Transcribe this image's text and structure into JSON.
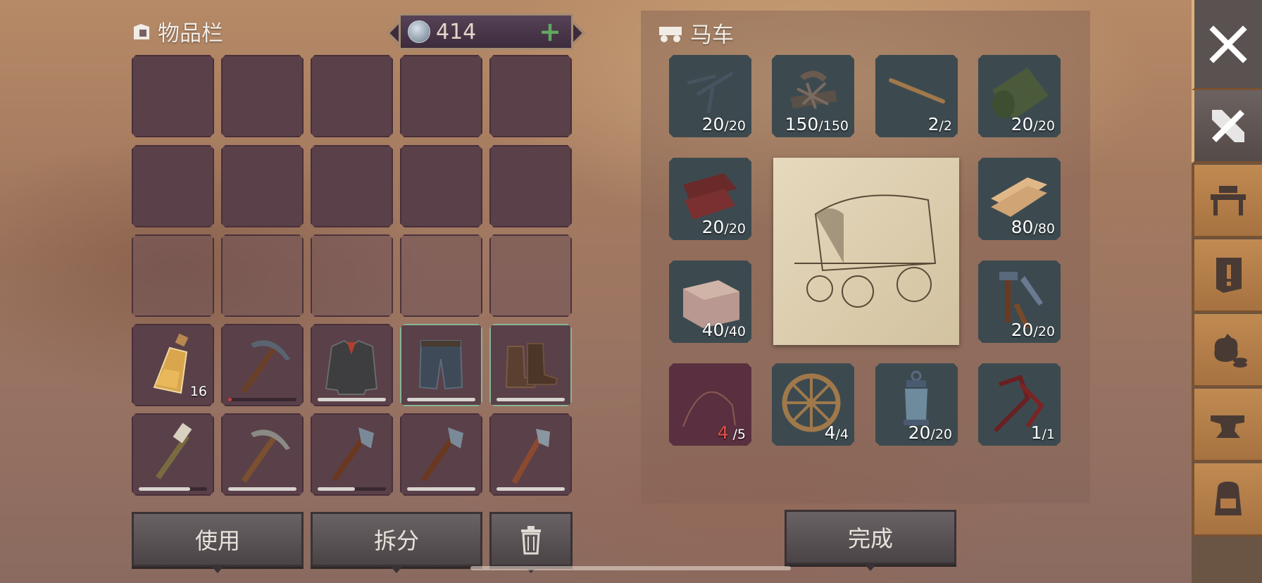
{
  "inventory": {
    "title": "物品栏",
    "currency": {
      "amount": "414",
      "add_symbol": "+"
    },
    "items": [
      {
        "name": "bottle",
        "count": "16"
      },
      {
        "name": "pickaxe-metal",
        "durability": 0.05
      },
      {
        "name": "leather-jacket",
        "durability": 1.0
      },
      {
        "name": "jeans",
        "durability": 1.0,
        "equipped": true
      },
      {
        "name": "boots",
        "durability": 1.0,
        "equipped": true
      },
      {
        "name": "torch",
        "durability": 0.75
      },
      {
        "name": "pickaxe-wood",
        "durability": 1.0
      },
      {
        "name": "hatchet-metal-1",
        "durability": 0.55
      },
      {
        "name": "hatchet-metal-2",
        "durability": 1.0
      },
      {
        "name": "hatchet-wood",
        "durability": 1.0
      }
    ],
    "buttons": {
      "use": "使用",
      "split": "拆分"
    }
  },
  "cart": {
    "title": "马车",
    "materials": [
      {
        "name": "nails",
        "have": "20",
        "need": "/20"
      },
      {
        "name": "scrap-metal",
        "have": "150",
        "need": "/150"
      },
      {
        "name": "stick",
        "have": "2",
        "need": "/2"
      },
      {
        "name": "cloth-roll",
        "have": "20",
        "need": "/20"
      },
      {
        "name": "leather",
        "have": "20",
        "need": "/20"
      },
      {
        "name": "planks",
        "have": "80",
        "need": "/80"
      },
      {
        "name": "stone-block",
        "have": "40",
        "need": "/40"
      },
      {
        "name": "tools",
        "have": "20",
        "need": "/20"
      },
      {
        "name": "rope",
        "have": "4",
        "need": " /5",
        "short": true
      },
      {
        "name": "wheel",
        "have": "4",
        "need": "/4"
      },
      {
        "name": "lantern",
        "have": "20",
        "need": "/20"
      },
      {
        "name": "harness",
        "have": "1",
        "need": "/1"
      }
    ],
    "complete_label": "完成"
  },
  "sidebar": {
    "tabs": [
      "close-icon",
      "crafting-icon",
      "workbench-icon",
      "quest-icon",
      "trade-icon",
      "anvil-icon",
      "backpack-icon"
    ]
  },
  "colors": {
    "accent_green": "#5fa860",
    "short_red": "#e05048",
    "tab_orange": "#b47a46"
  }
}
